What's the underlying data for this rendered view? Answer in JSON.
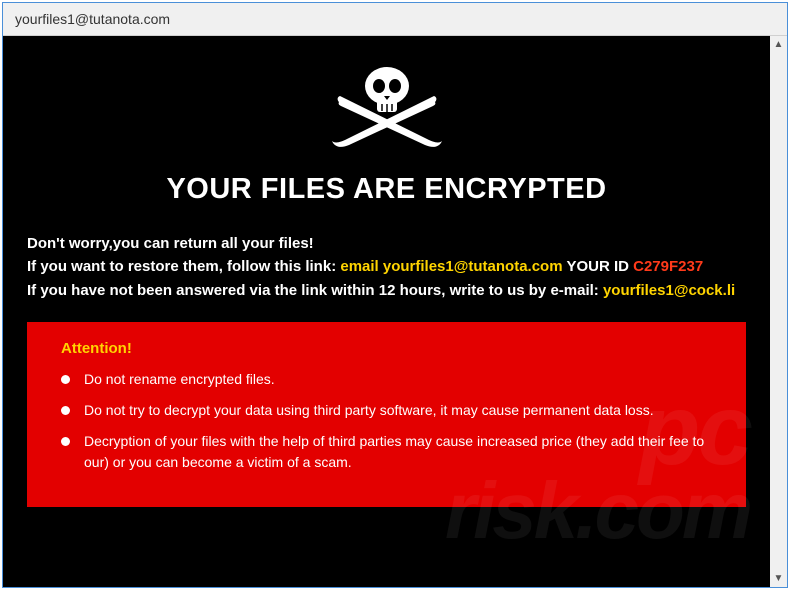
{
  "titlebar": {
    "title": "yourfiles1@tutanota.com"
  },
  "content": {
    "headline": "YOUR FILES ARE ENCRYPTED",
    "line1": "Don't worry,you can return all your files!",
    "line2_pre": "If you want to restore them, follow this link: ",
    "line2_email_label": "email yourfiles1@tutanota.com",
    "line2_yourid_label": " YOUR ID ",
    "line2_id": "C279F237",
    "line3_pre": "If you have not been answered via the link within 12 hours, write to us by e-mail: ",
    "line3_email": "yourfiles1@cock.li"
  },
  "attention": {
    "title": "Attention!",
    "bullets": [
      "Do not rename encrypted files.",
      "Do not try to decrypt your data using third party software, it may cause permanent data loss.",
      "Decryption of your files with the help of third parties may cause increased price (they add their fee to our) or you can become a victim of a scam."
    ]
  },
  "watermark": {
    "top": "pc",
    "bottom": "risk.com"
  }
}
